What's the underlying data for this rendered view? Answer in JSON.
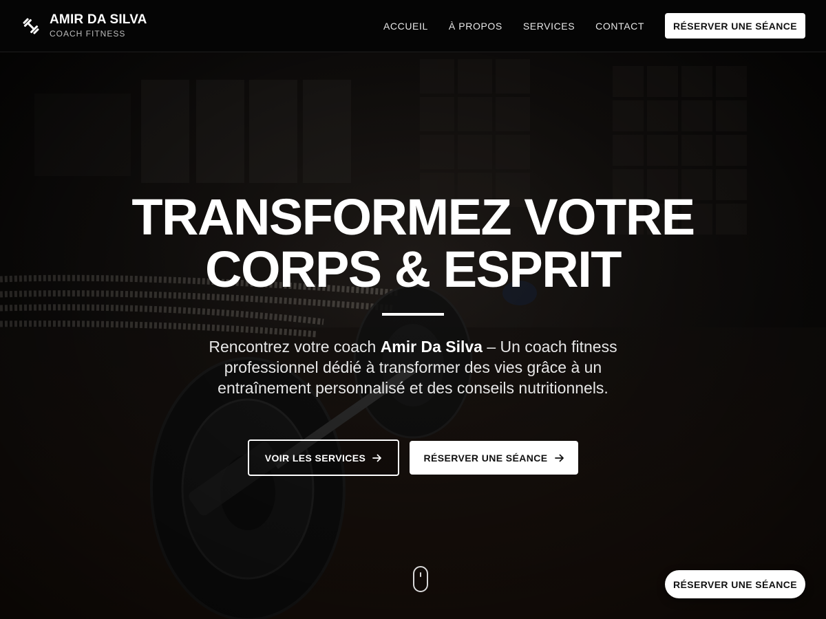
{
  "brand": {
    "name": "AMIR DA SILVA",
    "subtitle": "COACH FITNESS",
    "icon": "dumbbell-icon"
  },
  "nav": {
    "items": [
      {
        "label": "ACCUEIL"
      },
      {
        "label": "À PROPOS"
      },
      {
        "label": "SERVICES"
      },
      {
        "label": "CONTACT"
      }
    ],
    "cta_label": "RÉSERVER UNE SÉANCE"
  },
  "hero": {
    "title_line1": "TRANSFORMEZ VOTRE",
    "title_line2": "CORPS & ESPRIT",
    "desc_prefix": "Rencontrez votre coach ",
    "desc_name": "Amir Da Silva",
    "desc_suffix": " – Un coach fitness professionnel dédié à transformer des vies grâce à un entraînement personnalisé et des conseils nutritionnels.",
    "btn_services_label": "VOIR LES SERVICES",
    "btn_book_label": "RÉSERVER UNE SÉANCE",
    "scroll_icon": "mouse-scroll-icon",
    "background": "gym-barbell-photo"
  },
  "floating_cta": {
    "label": "RÉSERVER UNE SÉANCE"
  },
  "colors": {
    "header_bg": "#050505",
    "accent": "#ffffff",
    "button_text": "#111111"
  }
}
